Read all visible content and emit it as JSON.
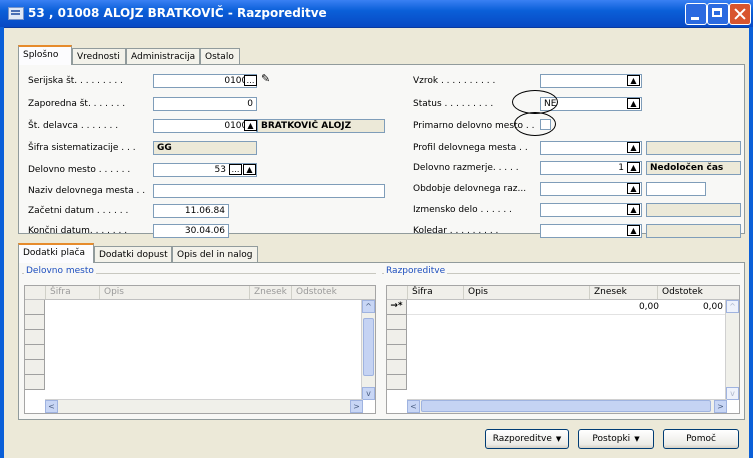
{
  "window": {
    "title": "53 , 01008 ALOJZ BRATKOVIČ - Razporeditve"
  },
  "top_tabs": [
    "Splošno",
    "Vrednosti",
    "Administracija",
    "Ostalo"
  ],
  "left_fields": [
    {
      "label": "Serijska št. . . . . . . . .",
      "value": "01008"
    },
    {
      "label": "Zaporedna št. . . . . . .",
      "value": "0"
    },
    {
      "label": "Št. delavca . . . . . . .",
      "value": "01008",
      "extra": "BRATKOVIČ ALOJZ"
    },
    {
      "label": "Šifra sistematizacije . . .",
      "value": "GG"
    },
    {
      "label": "Delovno mesto . . . . . .",
      "value": "53"
    },
    {
      "label": "Naziv delovnega mesta . .",
      "value": ""
    },
    {
      "label": "Začetni datum . . . . . .",
      "value": "11.06.84"
    },
    {
      "label": "Končni datum. . . . . . .",
      "value": "30.04.06"
    }
  ],
  "right_fields": [
    {
      "label": "Vzrok . . . . . . . . . .",
      "value": ""
    },
    {
      "label": "Status . . . . . . . . .",
      "value": "NE"
    },
    {
      "label": "Primarno delovno mesto . .",
      "value": ""
    },
    {
      "label": "Profil delovnega mesta . .",
      "value": ""
    },
    {
      "label": "Delovno razmerje. . . . .",
      "value": "1",
      "extra": "Nedoločen čas"
    },
    {
      "label": "Obdobje delovnega raz...",
      "value": ""
    },
    {
      "label": "Izmensko delo . . . . . .",
      "value": ""
    },
    {
      "label": "Koledar . . . . . . . . .",
      "value": ""
    }
  ],
  "bottom_tabs": [
    "Dodatki plača",
    "Dodatki dopust",
    "Opis del in nalog"
  ],
  "left_group": {
    "title": "Delovno mesto",
    "columns": [
      "Šifra",
      "Opis",
      "Znesek",
      "Odstotek"
    ]
  },
  "right_group": {
    "title": "Razporeditve",
    "columns": [
      "Šifra",
      "Opis",
      "Znesek",
      "Odstotek"
    ],
    "row": {
      "marker": "→*",
      "znesek": "0,00",
      "odstotek": "0,00"
    }
  },
  "buttons": {
    "razporeditve": "Razporeditve",
    "postopki": "Postopki",
    "pomoc": "Pomoč"
  },
  "icons": {
    "lookup": "ellipsis-icon",
    "dropdown": "arrow-up-icon",
    "edit": "pencil-icon"
  }
}
